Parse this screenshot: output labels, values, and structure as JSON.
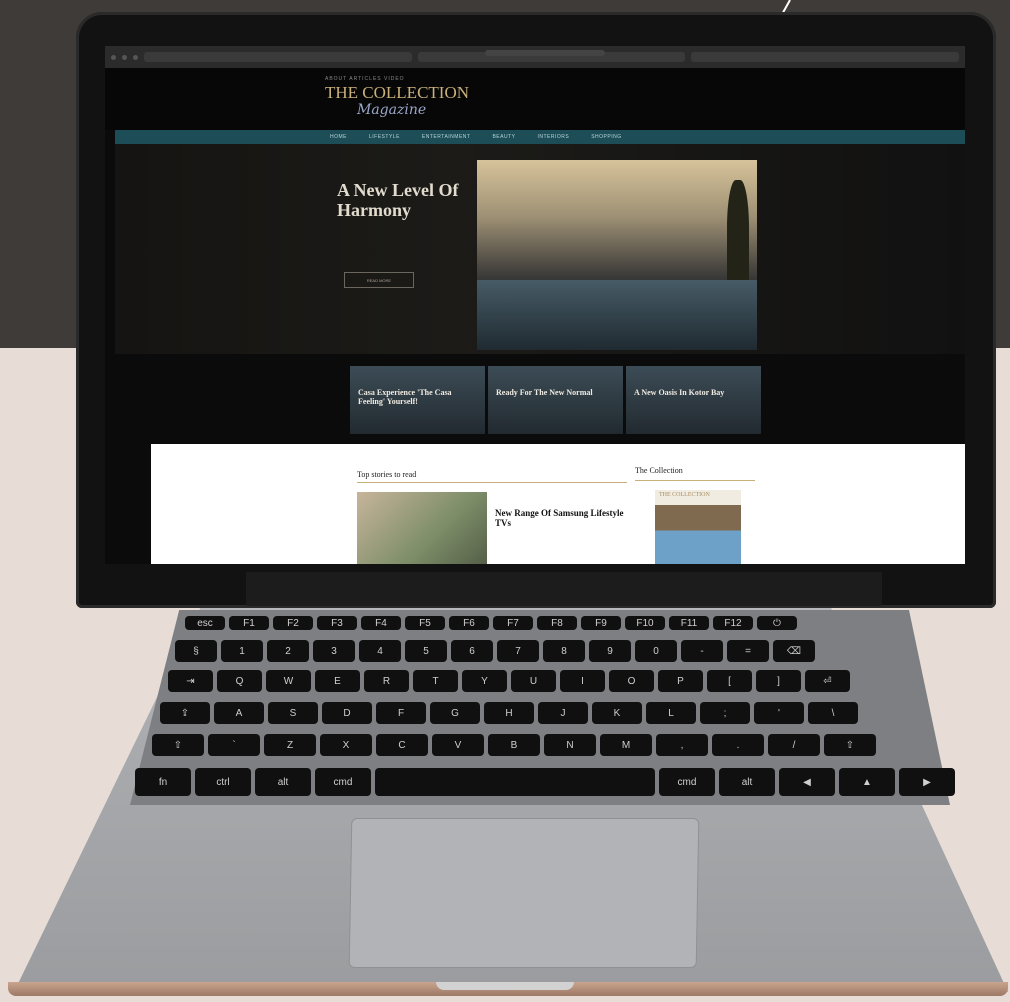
{
  "browser": {
    "tabs": [
      "",
      "",
      ""
    ]
  },
  "site": {
    "top_links": "ABOUT  ARTICLES  VIDEO",
    "logo_main": "THE COLLECTION",
    "logo_script": "Magazine",
    "nav": [
      "HOME",
      "LIFESTYLE",
      "ENTERTAINMENT",
      "BEAUTY",
      "INTERIORS",
      "SHOPPING"
    ],
    "hero": {
      "kicker": "",
      "title": "A New Level Of Harmony",
      "text": "",
      "button": "READ MORE"
    },
    "cards": [
      {
        "kicker": "",
        "title": "Casa Experience 'The Casa Feeling' Yourself!"
      },
      {
        "kicker": "",
        "title": "Ready For The New Normal"
      },
      {
        "kicker": "",
        "title": "A New Oasis In Kotor Bay"
      }
    ],
    "top_stories": {
      "title": "Top stories to read",
      "story": {
        "kicker": "",
        "title": "New Range Of Samsung Lifestyle TVs",
        "text": ""
      }
    },
    "sidebar": {
      "title": "The Collection",
      "magazine_logo": "THE COLLECTION"
    }
  },
  "keyboard": {
    "row1": [
      "esc",
      "F1",
      "F2",
      "F3",
      "F4",
      "F5",
      "F6",
      "F7",
      "F8",
      "F9",
      "F10",
      "F11",
      "F12",
      "⏻"
    ],
    "row2": [
      "§",
      "1",
      "2",
      "3",
      "4",
      "5",
      "6",
      "7",
      "8",
      "9",
      "0",
      "-",
      "=",
      "⌫"
    ],
    "row3": [
      "⇥",
      "Q",
      "W",
      "E",
      "R",
      "T",
      "Y",
      "U",
      "I",
      "O",
      "P",
      "[",
      "]",
      "⏎"
    ],
    "row4": [
      "⇪",
      "A",
      "S",
      "D",
      "F",
      "G",
      "H",
      "J",
      "K",
      "L",
      ";",
      "'",
      "\\"
    ],
    "row5": [
      "⇧",
      "`",
      "Z",
      "X",
      "C",
      "V",
      "B",
      "N",
      "M",
      ",",
      ".",
      "/",
      "⇧"
    ],
    "row6": [
      "fn",
      "ctrl",
      "alt",
      "cmd",
      "",
      "cmd",
      "alt",
      "◀",
      "▲",
      "▶"
    ]
  }
}
